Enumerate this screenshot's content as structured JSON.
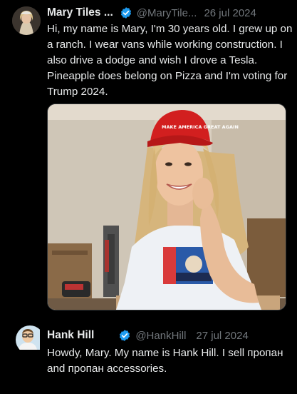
{
  "tweets": [
    {
      "author": "Mary Tiles ...",
      "handle": "@MaryTile...",
      "date": "26 jul 2024",
      "text": "Hi, my name is Mary, I'm 30 years old. I grew up on a ranch. I wear vans while working construction. I also drive a dodge and wish I drove a Tesla. Pineapple does belong on Pizza and I'm voting for Trump 2024.",
      "verified": true,
      "photo_hat_text": "MAKE AMERICA GREAT AGAIN"
    },
    {
      "author": "Hank Hill",
      "handle": "@HankHill",
      "date": "27 jul 2024",
      "text": "Howdy, Mary.  My name is Hank Hill.  I sell пропан and пропан accessories.",
      "verified": true
    }
  ],
  "colors": {
    "background": "#000000",
    "text": "#e7e9ea",
    "muted": "#71767b",
    "verified": "#1d9bf0"
  }
}
